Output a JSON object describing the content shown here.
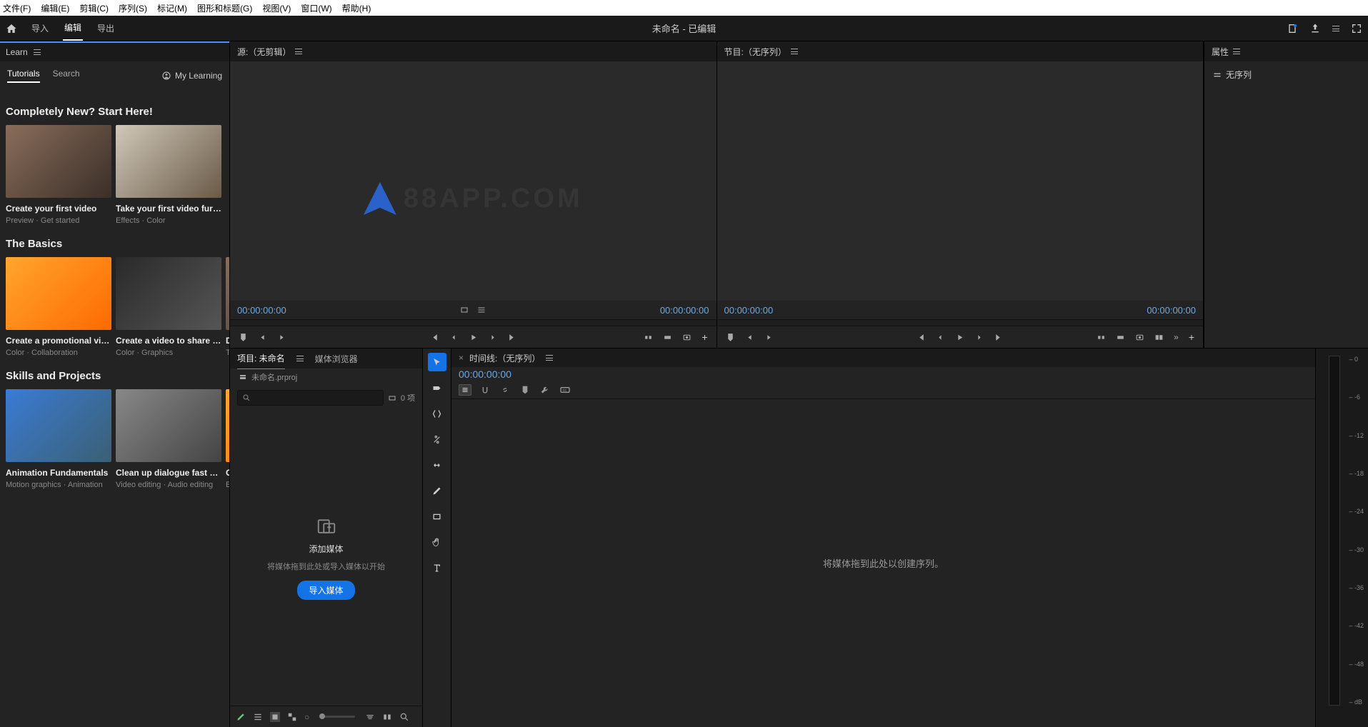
{
  "menubar": [
    "文件(F)",
    "编辑(E)",
    "剪辑(C)",
    "序列(S)",
    "标记(M)",
    "图形和标题(G)",
    "视图(V)",
    "窗口(W)",
    "帮助(H)"
  ],
  "topnav": {
    "tabs": [
      "导入",
      "编辑",
      "导出"
    ],
    "active": 1,
    "title": "未命名 - 已编辑"
  },
  "learn": {
    "panel_title": "Learn",
    "tabs": [
      "Tutorials",
      "Search"
    ],
    "mylearning": "My Learning",
    "sections": [
      {
        "title": "Completely New? Start Here!",
        "cards": [
          {
            "title": "Create your first video",
            "meta": "Preview · Get started",
            "thumb": "a"
          },
          {
            "title": "Take your first video further",
            "meta": "Effects · Color",
            "thumb": "b"
          }
        ]
      },
      {
        "title": "The Basics",
        "cards": [
          {
            "title": "Create a promotional video",
            "meta": "Color · Collaboration",
            "thumb": "c"
          },
          {
            "title": "Create a video to share on ...",
            "meta": "Color · Graphics",
            "thumb": "d"
          },
          {
            "title": "D",
            "meta": "Te",
            "thumb": "a"
          }
        ]
      },
      {
        "title": "Skills and Projects",
        "cards": [
          {
            "title": "Animation Fundamentals",
            "meta": "Motion graphics · Animation",
            "thumb": "e"
          },
          {
            "title": "Clean up dialogue fast wit...",
            "meta": "Video editing · Audio editing",
            "thumb": "f"
          },
          {
            "title": "C",
            "meta": "Ef",
            "thumb": "c"
          }
        ]
      }
    ]
  },
  "source": {
    "title": "源:（无剪辑）",
    "tc_in": "00:00:00:00",
    "tc_out": "00:00:00:00"
  },
  "program": {
    "title": "节目:（无序列）",
    "tc_in": "00:00:00:00",
    "tc_out": "00:00:00:00"
  },
  "properties": {
    "title": "属性",
    "no_sequence": "无序列"
  },
  "project": {
    "tab1": "项目: 未命名",
    "tab2": "媒体浏览器",
    "path": "未命名.prproj",
    "count": "0 项",
    "drop_title": "添加媒体",
    "drop_sub": "将媒体拖到此处或导入媒体以开始",
    "import_btn": "导入媒体"
  },
  "timeline": {
    "title": "时间线:（无序列）",
    "tc": "00:00:00:00",
    "empty": "将媒体拖到此处以创建序列。"
  },
  "watermark": "88APP.COM",
  "audio_meter": [
    "0",
    "-6",
    "-12",
    "-18",
    "-24",
    "-30",
    "-36",
    "-42",
    "-48",
    "dB"
  ]
}
